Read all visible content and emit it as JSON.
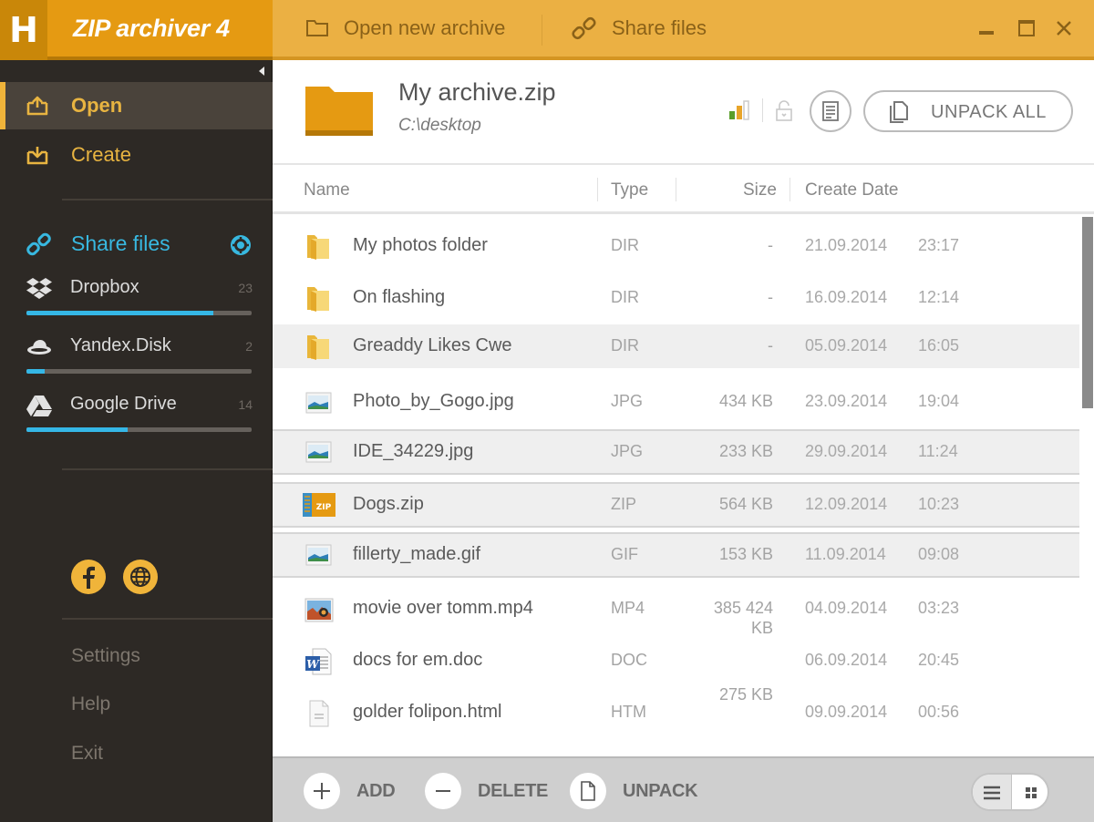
{
  "titlebar": {
    "logo_letter": "H",
    "app_name": "ZIP archiver 4",
    "open_new_archive": "Open new archive",
    "share_files": "Share files",
    "window_controls": [
      "minimize-icon",
      "maximize-icon",
      "close-icon"
    ]
  },
  "sidebar": {
    "nav": [
      {
        "label": "Open",
        "icon": "open-icon",
        "active": true
      },
      {
        "label": "Create",
        "icon": "create-icon",
        "active": false
      }
    ],
    "share_header": {
      "label": "Share files",
      "icon": "link-icon",
      "settings_icon": "gear-icon"
    },
    "clouds": [
      {
        "label": "Dropbox",
        "icon": "dropbox-icon",
        "count": "23",
        "usage_fraction": 0.83
      },
      {
        "label": "Yandex.Disk",
        "icon": "yandex-disk-icon",
        "count": "2",
        "usage_fraction": 0.08
      },
      {
        "label": "Google Drive",
        "icon": "google-drive-icon",
        "count": "14",
        "usage_fraction": 0.45
      }
    ],
    "social": [
      "facebook-icon",
      "globe-icon"
    ],
    "footer_links": [
      "Settings",
      "Help",
      "Exit"
    ]
  },
  "archive": {
    "name": "My archive.zip",
    "path": "C:\\desktop",
    "unpack_all_label": "UNPACK ALL",
    "colors": {
      "folder": "#e59a12",
      "accent": "#f0b43a",
      "cloud_bar": "#35b7e6"
    }
  },
  "columns": {
    "name": "Name",
    "type": "Type",
    "size": "Size",
    "date": "Create Date"
  },
  "files": [
    {
      "name": "My photos folder",
      "icon": "folder-icon",
      "type": "DIR",
      "size": "-",
      "date": "21.09.2014",
      "time": "23:17",
      "state": "normal"
    },
    {
      "name": "On flashing",
      "icon": "folder-icon",
      "type": "DIR",
      "size": "-",
      "date": "16.09.2014",
      "time": "12:14",
      "state": "normal"
    },
    {
      "name": "Greaddy Likes Cwe",
      "icon": "folder-icon",
      "type": "DIR",
      "size": "-",
      "date": "05.09.2014",
      "time": "16:05",
      "state": "hover"
    },
    {
      "name": "Photo_by_Gogo.jpg",
      "icon": "image-icon",
      "type": "JPG",
      "size": "434 KB",
      "date": "23.09.2014",
      "time": "19:04",
      "state": "normal"
    },
    {
      "name": "IDE_34229.jpg",
      "icon": "image-icon",
      "type": "JPG",
      "size": "233 KB",
      "date": "29.09.2014",
      "time": "11:24",
      "state": "selected"
    },
    {
      "name": "Dogs.zip",
      "icon": "zip-icon",
      "type": "ZIP",
      "size": "564 KB",
      "date": "12.09.2014",
      "time": "10:23",
      "state": "selected"
    },
    {
      "name": "fillerty_made.gif",
      "icon": "image-icon",
      "type": "GIF",
      "size": "153 KB",
      "date": "11.09.2014",
      "time": "09:08",
      "state": "selected"
    },
    {
      "name": "movie over tomm.mp4",
      "icon": "video-icon",
      "type": "MP4",
      "size": "385 424",
      "date": "04.09.2014",
      "time": "03:23",
      "state": "normal"
    },
    {
      "name": "docs for em.doc",
      "icon": "word-doc-icon",
      "type": "DOC",
      "size": "KB",
      "date": "06.09.2014",
      "time": "20:45",
      "state": "normal"
    },
    {
      "name": "golder folipon.html",
      "icon": "document-icon",
      "type": "HTM",
      "size": "275 KB",
      "date": "09.09.2014",
      "time": "00:56",
      "state": "normal"
    }
  ],
  "bottom_bar": {
    "add": "ADD",
    "delete": "DELETE",
    "unpack": "UNPACK",
    "view_modes": [
      "list-view-icon",
      "grid-view-icon"
    ]
  }
}
